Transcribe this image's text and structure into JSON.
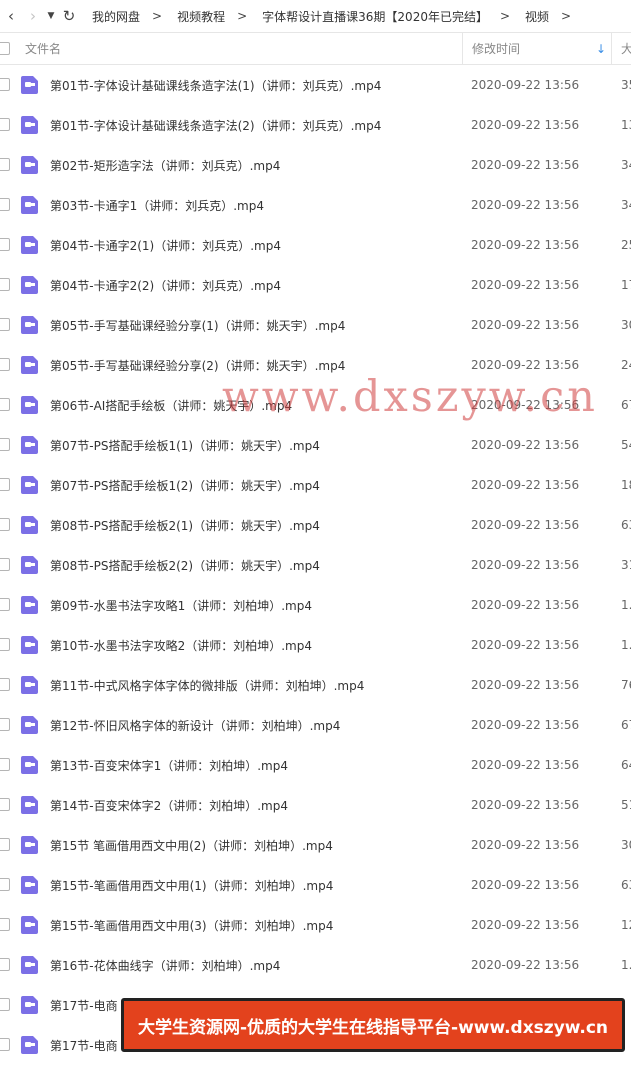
{
  "toolbar": {
    "back_icon": "chevron-left-icon",
    "forward_icon": "chevron-right-icon",
    "dropdown_icon": "caret-down-icon",
    "refresh_icon": "refresh-icon",
    "breadcrumb": [
      "我的网盘",
      "视频教程",
      "字体帮设计直播课36期【2020年已完结】",
      "视频"
    ]
  },
  "header": {
    "name": "文件名",
    "modified": "修改时间",
    "size": "大",
    "sort_icon": "arrow-down-icon"
  },
  "files": [
    {
      "name": "第01节-字体设计基础课线条造字法(1)（讲师：刘兵克）.mp4",
      "date": "2020-09-22 13:56",
      "size": "35"
    },
    {
      "name": "第01节-字体设计基础课线条造字法(2)（讲师：刘兵克）.mp4",
      "date": "2020-09-22 13:56",
      "size": "13"
    },
    {
      "name": "第02节-矩形造字法（讲师：刘兵克）.mp4",
      "date": "2020-09-22 13:56",
      "size": "34"
    },
    {
      "name": "第03节-卡通字1（讲师：刘兵克）.mp4",
      "date": "2020-09-22 13:56",
      "size": "34"
    },
    {
      "name": "第04节-卡通字2(1)（讲师：刘兵克）.mp4",
      "date": "2020-09-22 13:56",
      "size": "25"
    },
    {
      "name": "第04节-卡通字2(2)（讲师：刘兵克）.mp4",
      "date": "2020-09-22 13:56",
      "size": "17"
    },
    {
      "name": "第05节-手写基础课经验分享(1)（讲师：姚天宇）.mp4",
      "date": "2020-09-22 13:56",
      "size": "30"
    },
    {
      "name": "第05节-手写基础课经验分享(2)（讲师：姚天宇）.mp4",
      "date": "2020-09-22 13:56",
      "size": "24"
    },
    {
      "name": "第06节-AI搭配手绘板（讲师：姚天宇）.mp4",
      "date": "2020-09-22 13:56",
      "size": "67"
    },
    {
      "name": "第07节-PS搭配手绘板1(1)（讲师：姚天宇）.mp4",
      "date": "2020-09-22 13:56",
      "size": "54"
    },
    {
      "name": "第07节-PS搭配手绘板1(2)（讲师：姚天宇）.mp4",
      "date": "2020-09-22 13:56",
      "size": "18"
    },
    {
      "name": "第08节-PS搭配手绘板2(1)（讲师：姚天宇）.mp4",
      "date": "2020-09-22 13:56",
      "size": "63"
    },
    {
      "name": "第08节-PS搭配手绘板2(2)（讲师：姚天宇）.mp4",
      "date": "2020-09-22 13:56",
      "size": "31"
    },
    {
      "name": "第09节-水墨书法字攻略1（讲师：刘柏坤）.mp4",
      "date": "2020-09-22 13:56",
      "size": "1."
    },
    {
      "name": "第10节-水墨书法字攻略2（讲师：刘柏坤）.mp4",
      "date": "2020-09-22 13:56",
      "size": "1."
    },
    {
      "name": "第11节-中式风格字体字体的微排版（讲师：刘柏坤）.mp4",
      "date": "2020-09-22 13:56",
      "size": "76"
    },
    {
      "name": "第12节-怀旧风格字体的新设计（讲师：刘柏坤）.mp4",
      "date": "2020-09-22 13:56",
      "size": "67"
    },
    {
      "name": "第13节-百变宋体字1（讲师：刘柏坤）.mp4",
      "date": "2020-09-22 13:56",
      "size": "64"
    },
    {
      "name": "第14节-百变宋体字2（讲师：刘柏坤）.mp4",
      "date": "2020-09-22 13:56",
      "size": "51"
    },
    {
      "name": "第15节 笔画借用西文中用(2)（讲师：刘柏坤）.mp4",
      "date": "2020-09-22 13:56",
      "size": "30"
    },
    {
      "name": "第15节-笔画借用西文中用(1)（讲师：刘柏坤）.mp4",
      "date": "2020-09-22 13:56",
      "size": "63"
    },
    {
      "name": "第15节-笔画借用西文中用(3)（讲师：刘柏坤）.mp4",
      "date": "2020-09-22 13:56",
      "size": "12"
    },
    {
      "name": "第16节-花体曲线字（讲师：刘柏坤）.mp4",
      "date": "2020-09-22 13:56",
      "size": "1."
    },
    {
      "name": "第17节-电商",
      "date": "",
      "size": ""
    },
    {
      "name": "第17节-电商",
      "date": "",
      "size": ""
    }
  ],
  "watermark": "www.dxszyw.cn",
  "banner": "大学生资源网-优质的大学生在线指导平台-www.dxszyw.cn"
}
